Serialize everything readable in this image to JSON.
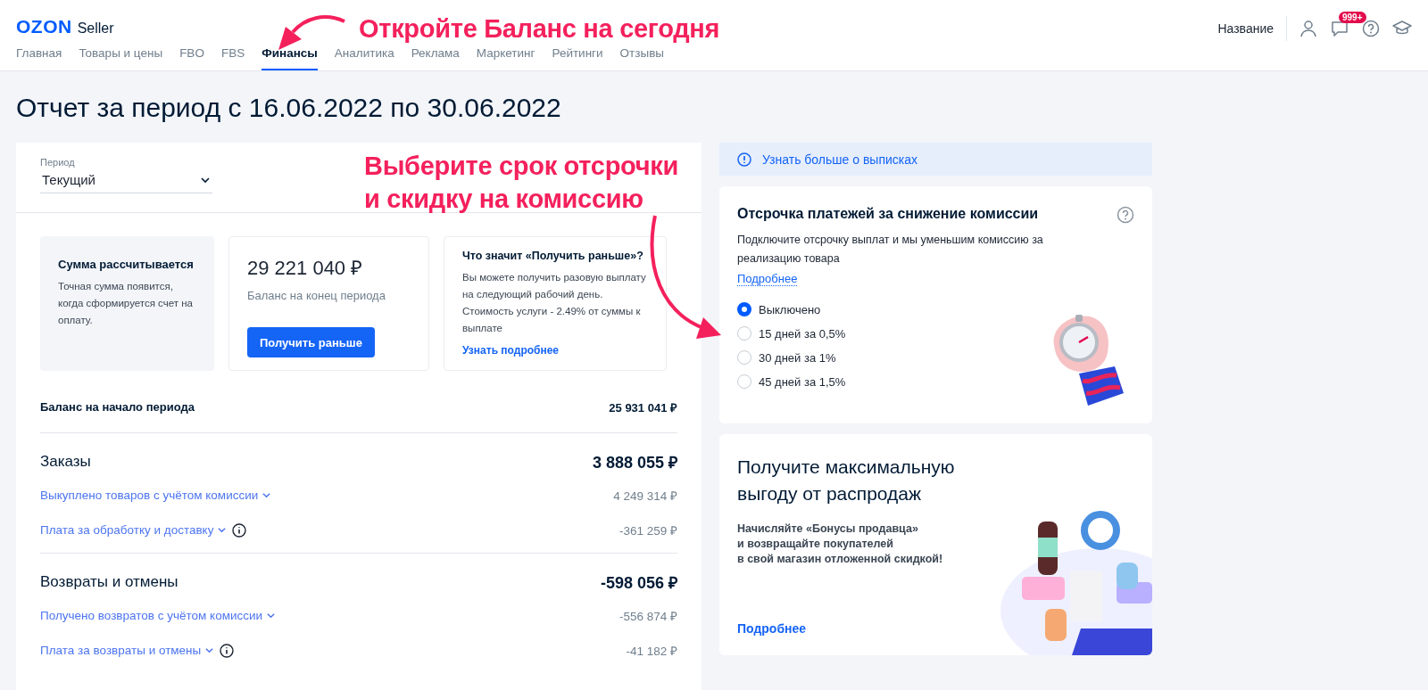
{
  "header": {
    "logo": "OZON",
    "logo_suffix": "Seller",
    "account": "Название",
    "chat_badge": "999+",
    "tabs": [
      {
        "label": "Главная",
        "selected": false
      },
      {
        "label": "Товары и цены",
        "selected": false
      },
      {
        "label": "FBO",
        "selected": false
      },
      {
        "label": "FBS",
        "selected": false
      },
      {
        "label": "Финансы",
        "selected": true
      },
      {
        "label": "Аналитика",
        "selected": false
      },
      {
        "label": "Реклама",
        "selected": false
      },
      {
        "label": "Маркетинг",
        "selected": false
      },
      {
        "label": "Рейтинги",
        "selected": false
      },
      {
        "label": "Отзывы",
        "selected": false
      }
    ]
  },
  "annotations": [
    "Откройте Баланс на сегодня",
    "Выберите срок отсрочки\nи скидку на комиссию"
  ],
  "title": "Отчет за период с 16.06.2022 по 30.06.2022",
  "period": {
    "label": "Период",
    "value": "Текущий"
  },
  "summary": {
    "pending": {
      "title": "Сумма рассчитывается",
      "text": "Точная сумма появится, когда сформируется счет на оплату."
    },
    "balance": {
      "amount": "29 221 040 ₽",
      "caption": "Баланс на конец периода",
      "button": "Получить раньше"
    },
    "faq": {
      "title": "Что значит «Получить раньше»?",
      "text": "Вы можете получить разовую выплату на следующий рабочий день. Стоимость услуги - 2.49% от суммы к выплате",
      "link": "Узнать подробнее"
    }
  },
  "sections": [
    {
      "kind": "balance",
      "label": "Баланс на начало периода",
      "value": "25 931 041 ₽"
    },
    {
      "kind": "group",
      "label": "Заказы",
      "value": "3 888 055 ₽",
      "items": [
        {
          "label": "Выкуплено товаров с учётом комиссии",
          "value": "4 249 314 ₽",
          "info": false
        },
        {
          "label": "Плата за обработку и доставку",
          "value": "-361 259 ₽",
          "info": true
        }
      ]
    },
    {
      "kind": "group",
      "label": "Возвраты и отмены",
      "value": "-598 056 ₽",
      "items": [
        {
          "label": "Получено возвратов с учётом комиссии",
          "value": "-556 874 ₽",
          "info": false
        },
        {
          "label": "Плата за возвраты и отмены",
          "value": "-41 182 ₽",
          "info": true
        }
      ]
    }
  ],
  "info_bar": "Узнать больше о выписках",
  "deferral": {
    "title": "Отсрочка платежей за снижение комиссии",
    "text": "Подключите отсрочку выплат и мы уменьшим комиссию за реализацию товара",
    "link": "Подробнее",
    "options": [
      {
        "label": "Выключено",
        "selected": true
      },
      {
        "label": "15 дней за 0,5%",
        "selected": false
      },
      {
        "label": "30 дней за 1%",
        "selected": false
      },
      {
        "label": "45 дней за 1,5%",
        "selected": false
      }
    ]
  },
  "promo": {
    "title": "Получите максимальную выгоду от распродаж",
    "text": "Начисляйте «Бонусы продавца»\nи возвращайте покупателей\nв свой магазин отложенной скидкой!",
    "link": "Подробнее"
  }
}
